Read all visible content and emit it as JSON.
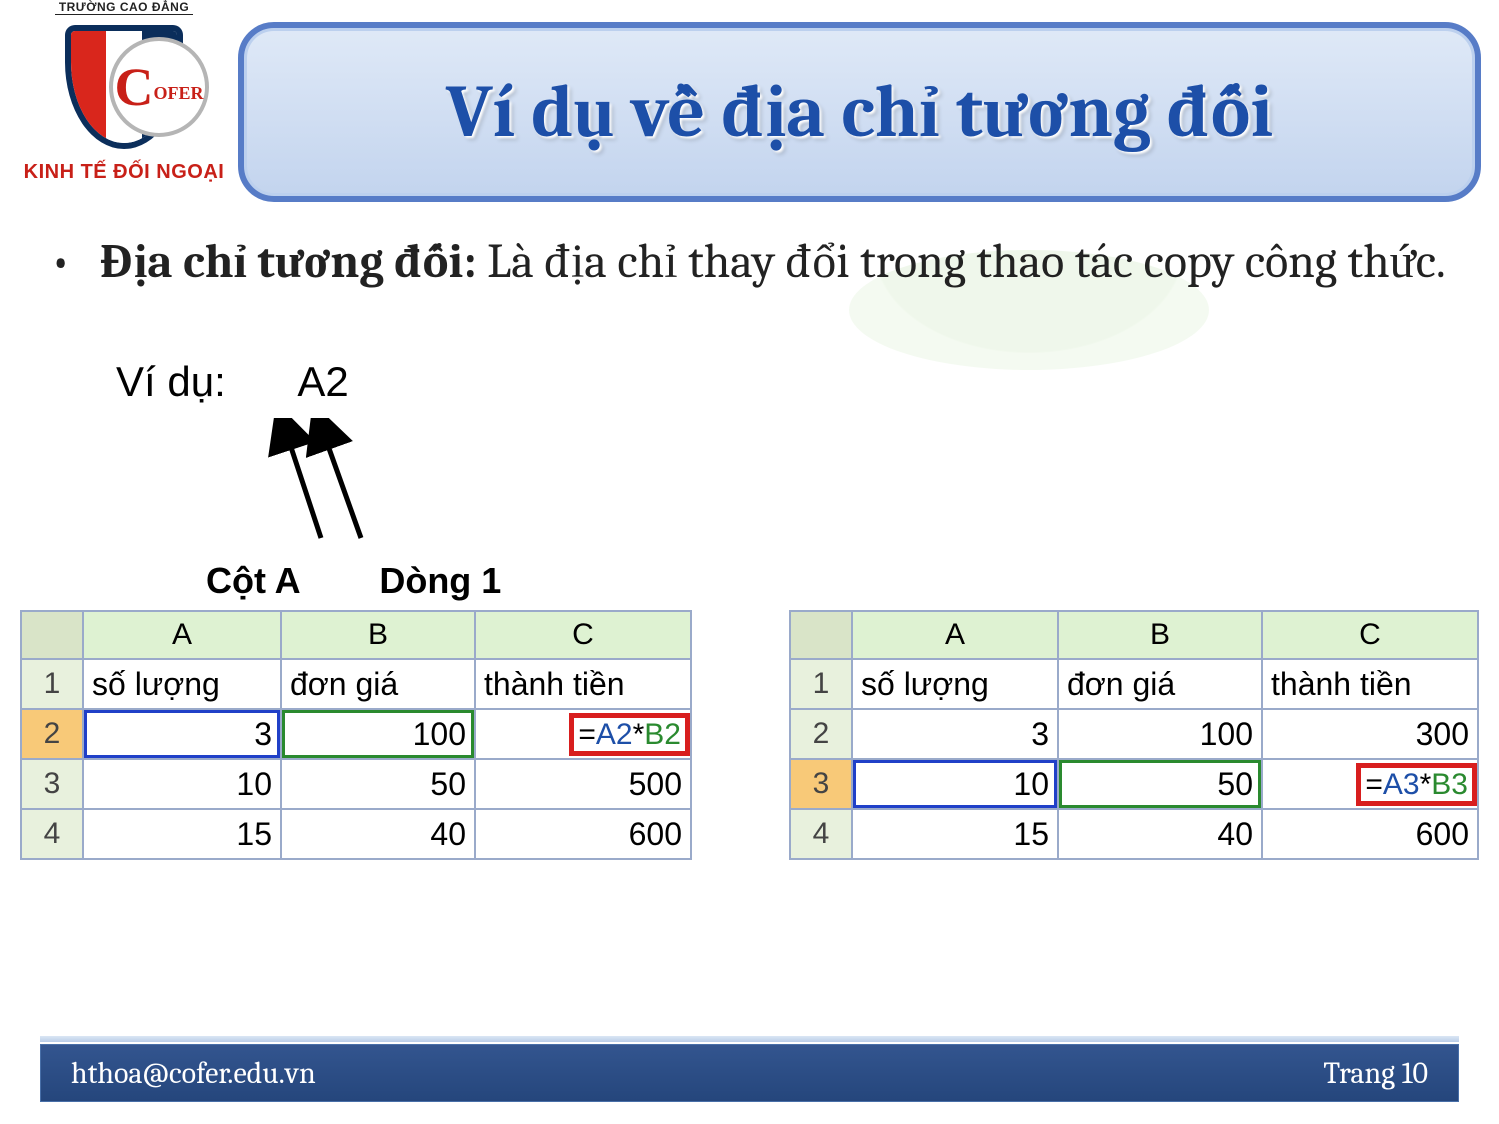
{
  "logo": {
    "top_text": "TRƯỜNG CAO ĐẲNG",
    "mark_big": "C",
    "mark_small": "OFER",
    "bottom_text": "KINH TẾ ĐỐI NGOẠI"
  },
  "title": "Ví dụ về địa chỉ tương đối",
  "bullet": {
    "label": "Địa chỉ tương đối:",
    "text": " Là địa chỉ thay đổi trong thao tác copy công thức."
  },
  "example": {
    "prefix": "Ví dụ:",
    "cell_ref": "A2",
    "col_label": "Cột A",
    "row_label": "Dòng 1"
  },
  "columns": {
    "A": "A",
    "B": "B",
    "C": "C"
  },
  "headers": {
    "qty": "số lượng",
    "price": "đơn giá",
    "amount": "thành tiền"
  },
  "table_left": {
    "active_row": "2",
    "formula_eq": "=",
    "formula_a": "A2",
    "formula_star": "*",
    "formula_b": "B2",
    "rows": [
      {
        "n": "1"
      },
      {
        "n": "2",
        "A": "3",
        "B": "100"
      },
      {
        "n": "3",
        "A": "10",
        "B": "50",
        "C": "500"
      },
      {
        "n": "4",
        "A": "15",
        "B": "40",
        "C": "600"
      }
    ]
  },
  "table_right": {
    "active_row": "3",
    "formula_eq": "=",
    "formula_a": "A3",
    "formula_star": "*",
    "formula_b": "B3",
    "rows": [
      {
        "n": "1"
      },
      {
        "n": "2",
        "A": "3",
        "B": "100",
        "C": "300"
      },
      {
        "n": "3",
        "A": "10",
        "B": "50"
      },
      {
        "n": "4",
        "A": "15",
        "B": "40",
        "C": "600"
      }
    ]
  },
  "footer": {
    "email": "hthoa@cofer.edu.vn",
    "page": "Trang 10"
  }
}
